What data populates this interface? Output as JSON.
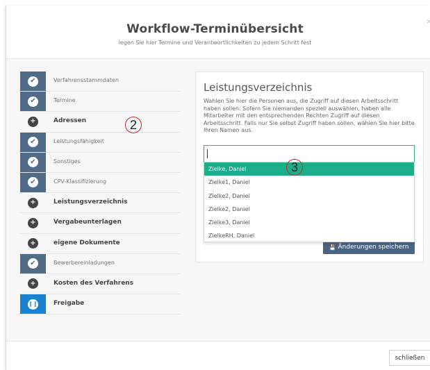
{
  "dialog": {
    "title": "Workflow-Terminübersicht",
    "subtitle": "legen Sie hier Termine und Verantwortlichkeiten zu jedem Schritt fest",
    "close_glyph": "×"
  },
  "steps": [
    {
      "label": "Verfahrensstammdaten",
      "state": "done"
    },
    {
      "label": "Termine",
      "state": "done"
    },
    {
      "label": "Adressen",
      "state": "open"
    },
    {
      "label": "Leistungsfähigkeit",
      "state": "done"
    },
    {
      "label": "Sonstiges",
      "state": "done"
    },
    {
      "label": "CPV-Klassifizierung",
      "state": "done"
    },
    {
      "label": "Leistungsverzeichnis",
      "state": "open"
    },
    {
      "label": "Vergabeunterlagen",
      "state": "open"
    },
    {
      "label": "eigene Dokumente",
      "state": "open"
    },
    {
      "label": "Bewerbereinladungen",
      "state": "done"
    },
    {
      "label": "Kosten des Verfahrens",
      "state": "open"
    },
    {
      "label": "Freigabe",
      "state": "active"
    }
  ],
  "panel": {
    "title": "Leistungsverzeichnis",
    "description": "Wahlen Sie hier die Personen aus, die Zugriff auf diesen Arbeitsschritt haben sollen. Sofern Sie niemanden speziell auswählen, haben alle Mitarbeiter mit den entsprechenden Rechten Zugriff auf diesen Arbeitsschritt. Falls nur Sie selbst Zugriff haben sollen, wählen Sie hier bitte Ihren Namen aus.",
    "input_value": "",
    "options": [
      "Zielke, Daniel",
      "Zielke1, Daniel",
      "Zielke2, Daniel",
      "Zielke2, Daniel",
      "Zielke3, Daniel",
      "ZielkeRH, Daniel"
    ],
    "selected_option": "Zielke, Daniel",
    "save_label": "Änderungen speichern"
  },
  "annotations": {
    "a2": "2",
    "a3": "3"
  },
  "footer": {
    "close_label": "schließen"
  },
  "colors": {
    "done_icon_bg": "#4f6b87",
    "active_icon_bg": "#1a82d2",
    "selected_option_bg": "#1bae8a",
    "input_border": "#26b28e",
    "save_button_bg": "#4a6484"
  },
  "icons": {
    "done": "check-circle-icon",
    "open": "plus-circle-icon",
    "active": "pause-circle-icon",
    "save": "floppy-disk-icon"
  }
}
